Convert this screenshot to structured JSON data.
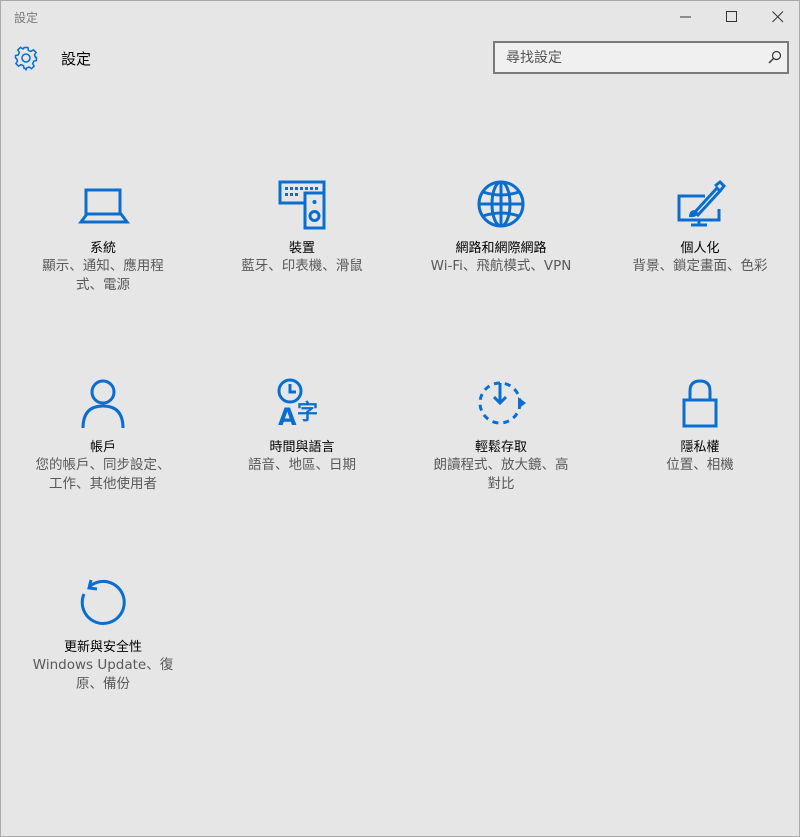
{
  "window": {
    "title": "設定"
  },
  "header": {
    "icon": "gear-icon",
    "title": "設定"
  },
  "search": {
    "placeholder": "尋找設定",
    "icon": "search-icon"
  },
  "accent_color": "#0a6ed1",
  "tiles": [
    {
      "icon": "laptop-icon",
      "title": "系統",
      "desc_line1": "顯示、通知、應用程",
      "desc_line2": "式、電源"
    },
    {
      "icon": "keyboard-speaker-icon",
      "title": "裝置",
      "desc_line1": "藍牙、印表機、滑鼠",
      "desc_line2": ""
    },
    {
      "icon": "globe-icon",
      "title": "網路和網際網路",
      "desc_line1": "Wi-Fi、飛航模式、VPN",
      "desc_line2": ""
    },
    {
      "icon": "paintbrush-monitor-icon",
      "title": "個人化",
      "desc_line1": "背景、鎖定畫面、色彩",
      "desc_line2": ""
    },
    {
      "icon": "person-icon",
      "title": "帳戶",
      "desc_line1": "您的帳戶、同步設定、",
      "desc_line2": "工作、其他使用者"
    },
    {
      "icon": "clock-language-icon",
      "title": "時間與語言",
      "desc_line1": "語音、地區、日期",
      "desc_line2": "",
      "glyph_a": "A",
      "glyph_zi": "字"
    },
    {
      "icon": "timer-arrow-icon",
      "title": "輕鬆存取",
      "desc_line1": "朗讀程式、放大鏡、高",
      "desc_line2": "對比"
    },
    {
      "icon": "padlock-icon",
      "title": "隱私權",
      "desc_line1": "位置、相機",
      "desc_line2": ""
    },
    {
      "icon": "refresh-arrow-icon",
      "title": "更新與安全性",
      "desc_line1": "Windows Update、復",
      "desc_line2": "原、備份"
    }
  ]
}
